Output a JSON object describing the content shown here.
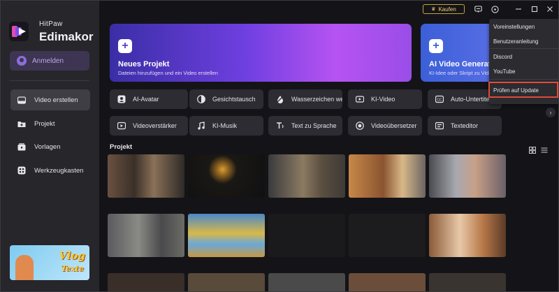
{
  "brand": {
    "top": "HitPaw",
    "name": "Edimakor"
  },
  "sidebar": {
    "login_label": "Anmelden",
    "items": [
      {
        "label": "Video erstellen",
        "active": true,
        "icon": "video-create-icon"
      },
      {
        "label": "Projekt",
        "active": false,
        "icon": "project-icon"
      },
      {
        "label": "Vorlagen",
        "active": false,
        "icon": "templates-icon"
      },
      {
        "label": "Werkzeugkasten",
        "active": false,
        "icon": "toolbox-icon"
      }
    ],
    "promo": {
      "line1": "Vlog",
      "line2": "Texte"
    }
  },
  "topbar": {
    "buy_label": "Kaufen"
  },
  "hero": [
    {
      "title": "Neues Projekt",
      "subtitle": "Dateien hinzufügen und ein Video erstellen"
    },
    {
      "title": "AI Video Generator",
      "subtitle": "KI-Idee oder Skript zu Video"
    }
  ],
  "tools": [
    {
      "label": "AI-Avatar",
      "icon": "avatar-icon"
    },
    {
      "label": "Gesichtstausch",
      "icon": "face-swap-icon"
    },
    {
      "label": "Wasserzeichen weg",
      "icon": "watermark-remove-icon"
    },
    {
      "label": "KI-Video",
      "icon": "ai-video-icon"
    },
    {
      "label": "Auto-Untertitel",
      "icon": "subtitle-icon"
    },
    {
      "label": "Videoverstärker",
      "icon": "video-enhancer-icon"
    },
    {
      "label": "KI-Musik",
      "icon": "ai-music-icon"
    },
    {
      "label": "Text zu Sprache",
      "icon": "text-to-speech-icon"
    },
    {
      "label": "Videoübersetzer",
      "icon": "video-translator-icon"
    },
    {
      "label": "Texteditor",
      "icon": "text-editor-icon"
    }
  ],
  "projects": {
    "title": "Projekt"
  },
  "menu": {
    "items": [
      "Voreinstellungen",
      "Benutzeranleitung",
      "Discord",
      "YouTube",
      "Prüfen auf Update"
    ],
    "highlighted": "Prüfen auf Update"
  },
  "colors": {
    "accent": "#8b6ed6",
    "highlight_border": "#e04a3a",
    "buy_border": "#c9a13b"
  }
}
